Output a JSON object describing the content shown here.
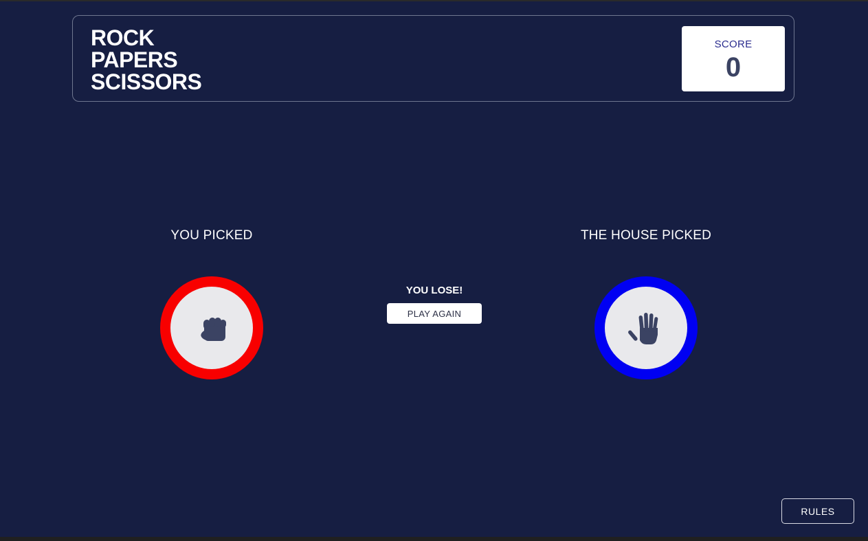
{
  "header": {
    "title_lines": [
      "ROCK",
      "PAPERS",
      "SCISSORS"
    ],
    "score_label": "SCORE",
    "score_value": "0"
  },
  "game": {
    "player_label": "YOU PICKED",
    "house_label": "THE HOUSE PICKED",
    "player_choice": {
      "icon": "rock-fist-icon",
      "ring_color": "#f80000"
    },
    "house_choice": {
      "icon": "paper-hand-icon",
      "ring_color": "#0000f2"
    },
    "result_text": "YOU LOSE!",
    "play_again_label": "PLAY AGAIN"
  },
  "footer": {
    "rules_label": "RULES"
  },
  "colors": {
    "background": "#161e42",
    "icon": "#3b4363",
    "token_face": "#e9e9ec"
  }
}
